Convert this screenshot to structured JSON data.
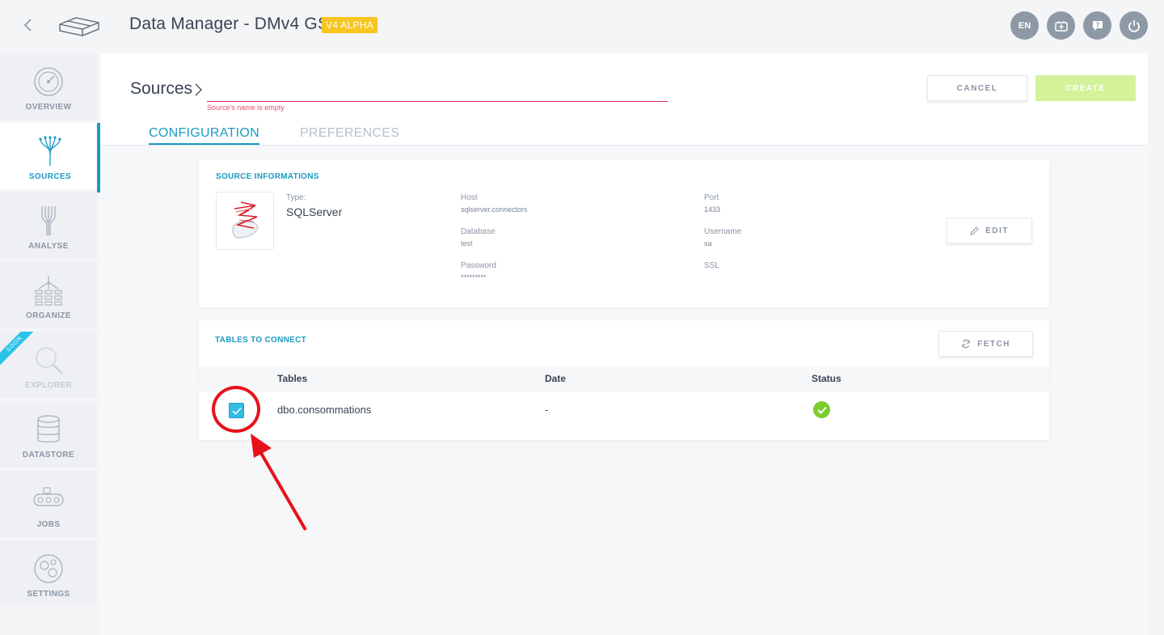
{
  "header": {
    "app_title": "Data Manager - DMv4 GS",
    "badge": "V4 ALPHA",
    "icons": [
      {
        "name": "language",
        "label": "EN"
      },
      {
        "name": "switch-board-icon",
        "label": ""
      },
      {
        "name": "help-icon",
        "label": ""
      },
      {
        "name": "power-icon",
        "label": ""
      }
    ]
  },
  "sidebar": {
    "items": [
      {
        "key": "overview",
        "label": "OVERVIEW",
        "icon": "gauge-icon",
        "active": false
      },
      {
        "key": "sources",
        "label": "SOURCES",
        "icon": "sources-tree-icon",
        "active": true
      },
      {
        "key": "analyse",
        "label": "ANALYSE",
        "icon": "analyse-funnel-icon",
        "active": false
      },
      {
        "key": "organize",
        "label": "ORGANIZE",
        "icon": "organize-icon",
        "active": false
      },
      {
        "key": "explorer",
        "label": "EXPLORER",
        "icon": "magnifier-icon",
        "active": false,
        "ribbon": "SOON"
      },
      {
        "key": "datastore",
        "label": "DATASTORE",
        "icon": "database-icon",
        "active": false
      },
      {
        "key": "jobs",
        "label": "JOBS",
        "icon": "conveyor-icon",
        "active": false
      },
      {
        "key": "settings",
        "label": "SETTINGS",
        "icon": "gears-icon",
        "active": false
      }
    ]
  },
  "main": {
    "breadcrumb": "Sources",
    "name_input": {
      "value": "",
      "placeholder": ""
    },
    "error": "Source's name is empty",
    "cancel_label": "CANCEL",
    "create_label": "CREATE",
    "tabs": [
      {
        "label": "CONFIGURATION",
        "active": true
      },
      {
        "label": "PREFERENCES",
        "active": false
      }
    ]
  },
  "source_info": {
    "title": "SOURCE INFORMATIONS",
    "type_label": "Type:",
    "type_value": "SQLServer",
    "fields": {
      "host_label": "Host",
      "host_value": "sqlserver.connectors",
      "port_label": "Port",
      "port_value": "1433",
      "database_label": "Database",
      "database_value": "test",
      "username_label": "Username",
      "username_value": "sa",
      "password_label": "Password",
      "password_value": "*********",
      "ssl_label": "SSL"
    },
    "edit_label": "EDIT"
  },
  "tables": {
    "title": "TABLES TO CONNECT",
    "fetch_label": "FETCH",
    "columns": [
      "Tables",
      "Date",
      "Status"
    ],
    "rows": [
      {
        "checked": true,
        "table": "dbo.consommations",
        "date": "-",
        "status": "ok"
      }
    ]
  },
  "colors": {
    "accent": "#1a9bc3",
    "badge": "#f7c520",
    "create_disabled": "#d4f29a",
    "error": "#d52b5a",
    "annotation": "#e8111b",
    "status_ok": "#7ccb2e"
  }
}
